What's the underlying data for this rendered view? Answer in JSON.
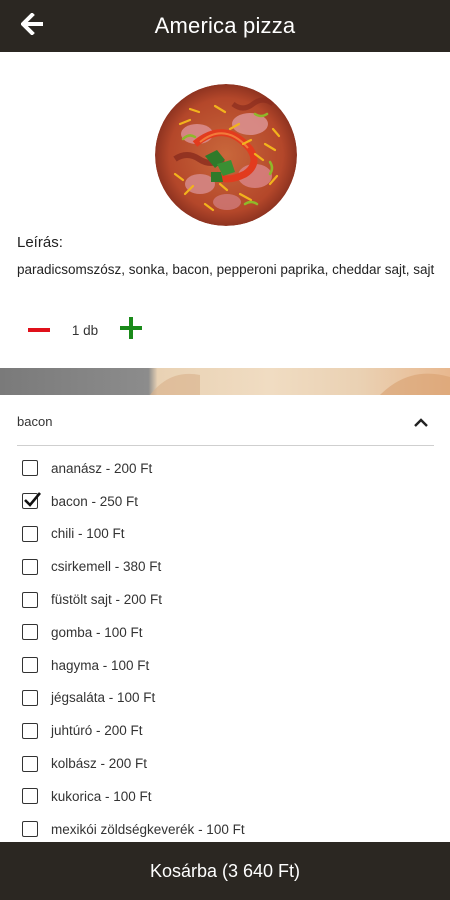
{
  "header": {
    "title": "America pizza",
    "back_icon": "arrow-left-icon"
  },
  "product": {
    "image_name": "pizza-image",
    "description_label": "Leírás:",
    "description": "paradicsomszósz, sonka, bacon, pepperoni paprika, cheddar sajt, sajt"
  },
  "quantity": {
    "value": "1 db",
    "minus_icon": "minus-icon",
    "plus_icon": "plus-icon",
    "minus_color": "#e0101a",
    "plus_color": "#1a8a1a"
  },
  "extras": {
    "selected_label": "bacon",
    "chevron_icon": "chevron-up-icon",
    "options": [
      {
        "label": "ananász - 200 Ft",
        "checked": false
      },
      {
        "label": "bacon - 250 Ft",
        "checked": true
      },
      {
        "label": "chili - 100 Ft",
        "checked": false
      },
      {
        "label": "csirkemell - 380 Ft",
        "checked": false
      },
      {
        "label": "füstölt sajt - 200 Ft",
        "checked": false
      },
      {
        "label": "gomba - 100 Ft",
        "checked": false
      },
      {
        "label": "hagyma - 100 Ft",
        "checked": false
      },
      {
        "label": "jégsaláta - 100 Ft",
        "checked": false
      },
      {
        "label": "juhtúró - 200 Ft",
        "checked": false
      },
      {
        "label": "kolbász - 200 Ft",
        "checked": false
      },
      {
        "label": "kukorica - 100 Ft",
        "checked": false
      },
      {
        "label": "mexikói zöldségkeverék - 100 Ft",
        "checked": false
      }
    ]
  },
  "footer": {
    "cart_button_label": "Kosárba (3 640 Ft)"
  },
  "colors": {
    "bar_background": "#2b2722",
    "text": "#1f1f1f"
  }
}
